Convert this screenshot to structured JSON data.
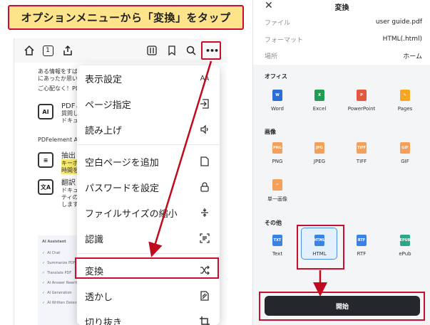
{
  "banner": {
    "text": "オプションメニューから「変換」をタップ"
  },
  "toolbar": {
    "icons": [
      "home-icon",
      "page-number-icon",
      "share-icon",
      "reader-settings-icon",
      "bookmark-icon",
      "search-icon",
      "more-icon"
    ],
    "page_number": "1",
    "more_glyph": "•••"
  },
  "document": {
    "line1": "ある情報をすばやく",
    "line2": "にあったか思い",
    "line3": "ご心配なく！PDF",
    "feature1_title": "PDFと",
    "feature1_sub1": "質問し",
    "feature1_sub2": "ドキュ",
    "line4": "PDFelement AI ",
    "feature2_title": "抽出と",
    "feature2_sub1": "キーポ",
    "feature2_sub2": "時間を",
    "feature3_title": "翻訳と",
    "feature3_sub1": "ドキュ",
    "feature3_sub2": "ティの",
    "feature3_sub3": "します",
    "icon_ai": "AI",
    "mini_title": "AI Assistant",
    "mini_items": [
      "AI Chat",
      "Summarize PDF",
      "Translate PDF",
      "AI Answer Rewrite",
      "AI Generation",
      "AI Written Detection"
    ]
  },
  "menu": {
    "items": [
      {
        "label": "表示設定",
        "icon": "text-size-icon",
        "glyph": "Aᴀ"
      },
      {
        "label": "ページ指定",
        "icon": "go-to-page-icon",
        "glyph": "→"
      },
      {
        "label": "読み上げ",
        "icon": "speaker-icon",
        "glyph": "🔈"
      },
      {
        "label": "空白ページを追加",
        "icon": "blank-page-icon",
        "glyph": "▯"
      },
      {
        "label": "パスワードを設定",
        "icon": "lock-icon",
        "glyph": "🔒"
      },
      {
        "label": "ファイルサイズの縮小",
        "icon": "compress-icon",
        "glyph": "÷"
      },
      {
        "label": "認識",
        "icon": "ocr-icon",
        "glyph": "⌷"
      },
      {
        "label": "変換",
        "icon": "shuffle-icon",
        "glyph": "⤨"
      },
      {
        "label": "透かし",
        "icon": "watermark-icon",
        "glyph": "▨"
      },
      {
        "label": "切り抜き",
        "icon": "crop-icon",
        "glyph": "⌗"
      }
    ]
  },
  "convert": {
    "title": "変換",
    "close": "✕",
    "file_key": "ファイル",
    "file_val": "user guide.pdf",
    "format_key": "フォーマット",
    "format_val": "HTML(.html)",
    "location_key": "場所",
    "location_val": "ホーム",
    "section_office": "オフィス",
    "section_image": "画像",
    "section_other": "その他",
    "office": [
      {
        "label": "Word",
        "color": "#2b6fd6",
        "mark": "W"
      },
      {
        "label": "Excel",
        "color": "#1f9d55",
        "mark": "X"
      },
      {
        "label": "PowerPoint",
        "color": "#e2573d",
        "mark": "P"
      },
      {
        "label": "Pages",
        "color": "#f5a623",
        "mark": "✎"
      }
    ],
    "image": [
      {
        "label": "PNG",
        "color": "#f5a05a",
        "mark": "PNG"
      },
      {
        "label": "JPEG",
        "color": "#f5a05a",
        "mark": "JPG"
      },
      {
        "label": "TIFF",
        "color": "#f5a05a",
        "mark": "TIFF"
      },
      {
        "label": "GIF",
        "color": "#f5a05a",
        "mark": "GIF"
      },
      {
        "label": "単一画像",
        "color": "#f5a05a",
        "mark": "~"
      }
    ],
    "other": [
      {
        "label": "Text",
        "color": "#3b82e6",
        "mark": "TXT"
      },
      {
        "label": "HTML",
        "color": "#3b82e6",
        "mark": "HTML"
      },
      {
        "label": "RTF",
        "color": "#3b82e6",
        "mark": "RTF"
      },
      {
        "label": "ePub",
        "color": "#2aa887",
        "mark": "EPUB"
      }
    ],
    "start_label": "開始"
  },
  "colors": {
    "highlight_red": "#c8102e",
    "banner_yellow": "#fde38a",
    "selected_blue": "#4a8ee8",
    "start_button": "#24272b"
  }
}
